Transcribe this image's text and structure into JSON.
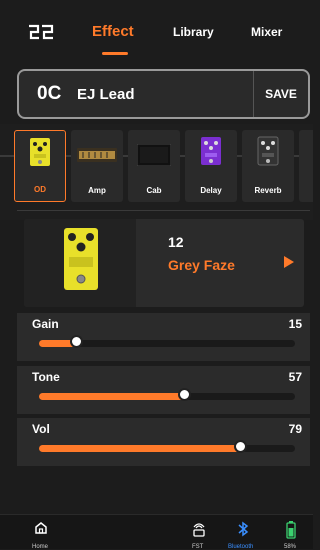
{
  "header": {
    "tabs": [
      {
        "label": "Effect"
      },
      {
        "label": "Library"
      },
      {
        "label": "Mixer"
      }
    ]
  },
  "preset": {
    "number": "0C",
    "name": "EJ Lead",
    "save_label": "SAVE"
  },
  "chain": {
    "slots": [
      {
        "label": "OD"
      },
      {
        "label": "Amp"
      },
      {
        "label": "Cab"
      },
      {
        "label": "Delay"
      },
      {
        "label": "Reverb"
      }
    ]
  },
  "effect": {
    "number": "12",
    "name": "Grey Faze"
  },
  "params": [
    {
      "label": "Gain",
      "value": "15",
      "level": 0.15
    },
    {
      "label": "Tone",
      "value": "57",
      "level": 0.57
    },
    {
      "label": "Vol",
      "value": "79",
      "level": 0.79
    }
  ],
  "bottom": {
    "home_label": "Home",
    "fst_label": "FST",
    "bluetooth_label": "Bluetooth",
    "battery_label": "58%"
  },
  "colors": {
    "accent": "#ff7a2a",
    "background": "#1c1c1c",
    "pedal_yellow": "#e8e02a",
    "pedal_purple": "#7b2fd1"
  }
}
